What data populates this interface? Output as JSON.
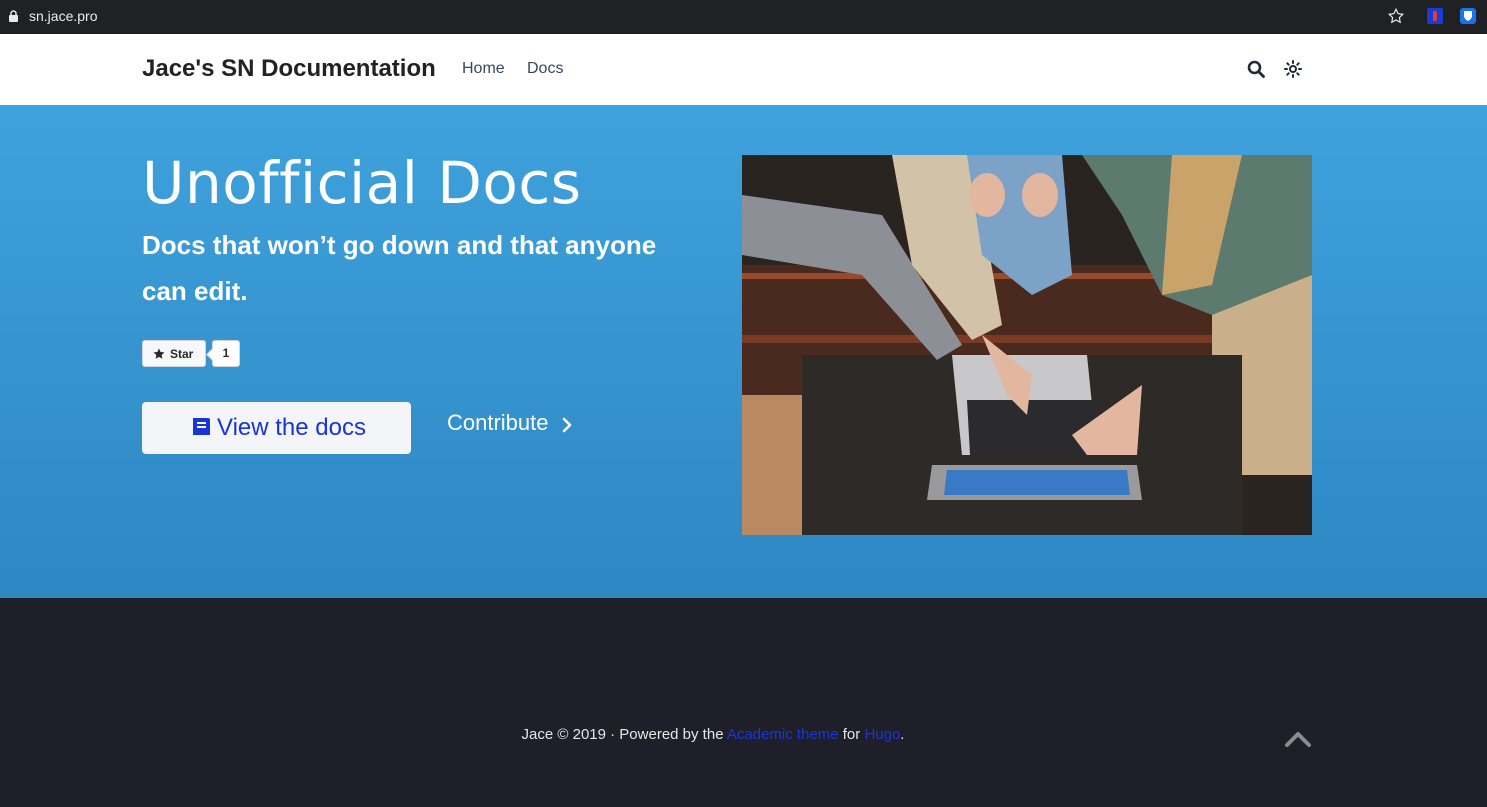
{
  "browser": {
    "url": "sn.jace.pro",
    "icons": [
      "lock-icon",
      "bookmark-star-icon",
      "extension-icon",
      "bitwarden-icon"
    ]
  },
  "navbar": {
    "brand": "Jace's SN Documentation",
    "links": [
      "Home",
      "Docs"
    ],
    "icons": [
      "search-icon",
      "theme-toggle-icon"
    ]
  },
  "hero": {
    "title": "Unofficial Docs",
    "subtitle": "Docs that won’t go down and that anyone can edit.",
    "github_star": {
      "label": "Star",
      "count": "1"
    },
    "primary_button": "View the docs",
    "secondary_link": "Contribute",
    "image_alt": "people pointing at laptop"
  },
  "footer": {
    "text_before": "Jace © 2019 · Powered by the ",
    "theme_link": "Academic theme",
    "text_middle": " for ",
    "hugo_link": "Hugo",
    "text_after": "."
  },
  "colors": {
    "hero_top": "#3fa2dc",
    "hero_bottom": "#2d87c3",
    "footer_bg": "#1f1f29",
    "link": "#1a35d6"
  }
}
